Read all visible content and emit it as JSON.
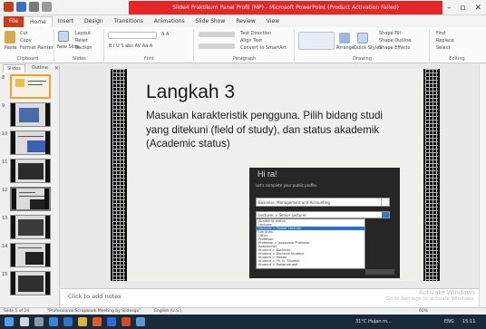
{
  "window": {
    "title": "Slide4 Praktikum Panel Profil (MP) - Microsoft PowerPoint (Product Activation Failed)",
    "controls": [
      "–",
      "▫",
      "✕"
    ]
  },
  "ribbon_tabs": [
    "File",
    "Home",
    "Insert",
    "Design",
    "Transitions",
    "Animations",
    "Slide Show",
    "Review",
    "View"
  ],
  "ribbon": {
    "clipboard": {
      "paste": "Paste",
      "cut": "Cut",
      "copy": "Copy",
      "format_painter": "Format Painter",
      "label": "Clipboard"
    },
    "slides": {
      "new_slide": "New Slide",
      "layout": "Layout",
      "reset": "Reset",
      "section": "Section",
      "label": "Slides"
    },
    "font": {
      "label": "Font",
      "size": "A A",
      "styles": "B I U S abc AV Aa A"
    },
    "paragraph": {
      "label": "Paragraph",
      "text_direction": "Text Direction",
      "align_text": "Align Text",
      "convert": "Convert to SmartArt"
    },
    "drawing": {
      "label": "Drawing",
      "arrange": "Arrange",
      "quick_styles": "Quick Styles",
      "shape_fill": "Shape Fill",
      "shape_outline": "Shape Outline",
      "shape_effects": "Shape Effects"
    },
    "editing": {
      "label": "Editing",
      "find": "Find",
      "replace": "Replace",
      "select": "Select"
    }
  },
  "panel": {
    "tabs": [
      "Slides",
      "Outline"
    ],
    "close": "✕",
    "slide_numbers": [
      "8",
      "9",
      "10",
      "11",
      "12",
      "13",
      "14",
      "15"
    ]
  },
  "slide": {
    "title": "Langkah 3",
    "body": "Masukan karakteristik pengguna. Pilih bidang studi yang ditekuni (field of study), dan status akademik (Academic status)",
    "embedded_screenshot": {
      "heading": "Hi ra!",
      "subheading": "Let's complete your public profile.",
      "field_of_study": "Business, Management and Accounting",
      "status_select": "Lecturer > Senior Lecturer",
      "options": [
        "Academic status",
        "Lecturer",
        "Lecturer > Senior Lecturer",
        "Librarian",
        "Other",
        "Professor",
        "Professor > Associate Professor",
        "Researcher",
        "Student > Bachelor",
        "Student > Doctoral Student",
        "Student > Master",
        "Student > Ph. D. Student",
        "Student > Postgraduate"
      ],
      "selected_index": 2
    }
  },
  "notes": {
    "placeholder": "Click to add notes",
    "activation_title": "Activate Windows",
    "activation_sub": "Go to Settings to activate Windows."
  },
  "status_bar": {
    "slide_info": "Slide 5 of 24",
    "theme": "\"Professional Scrapbook Meeting by Slidesgo\"",
    "language": "English (U.S.)",
    "zoom": "60%"
  },
  "taskbar": {
    "weather": "31°C Hujan m...",
    "language": "ENG",
    "time": "15:11"
  },
  "colors": {
    "title_bar_red": "#e32626",
    "file_tab": "#c43e1c",
    "selection_blue": "#2a6fd6",
    "taskbar": "#1b2a3a"
  }
}
